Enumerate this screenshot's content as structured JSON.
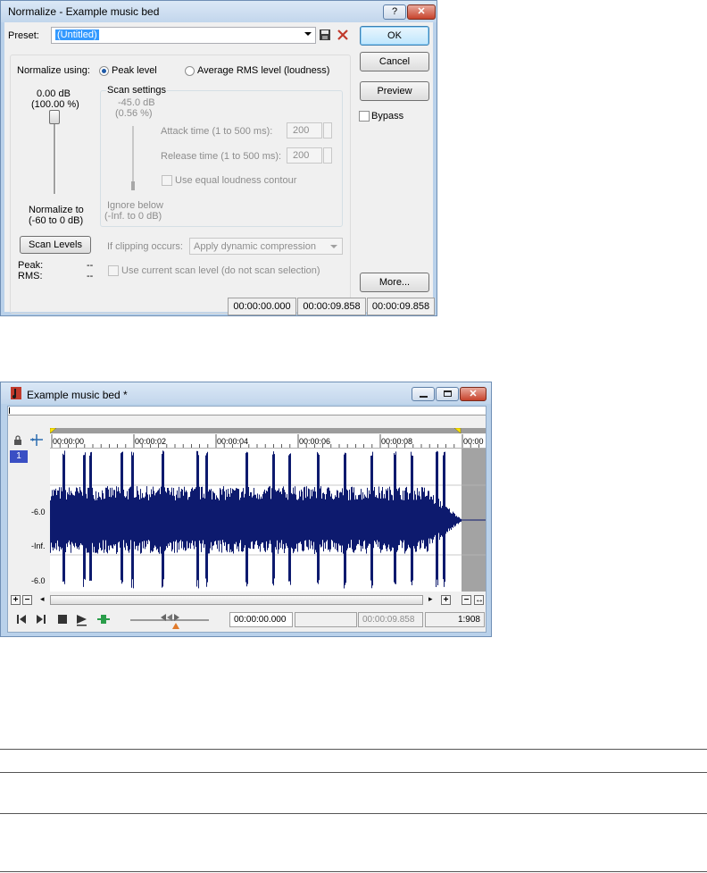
{
  "dialog": {
    "title": "Normalize - Example music bed",
    "help_label": "?",
    "close_label": "✕",
    "preset_label": "Preset:",
    "preset_value": "(Untitled)",
    "ok_label": "OK",
    "cancel_label": "Cancel",
    "preview_label": "Preview",
    "bypass_label": "Bypass",
    "more_label": "More...",
    "normalize_using_label": "Normalize using:",
    "peak_level_label": "Peak level",
    "average_rms_label": "Average RMS level (loudness)",
    "selected_mode": "Peak level",
    "slider_value_db": "0.00 dB",
    "slider_value_pct": "(100.00 %)",
    "slider_level": 1.0,
    "normalize_to_label": "Normalize to",
    "normalize_to_range": "(-60 to 0 dB)",
    "scan_settings_title": "Scan settings",
    "scan_value_db": "-45.0 dB",
    "scan_value_pct": "(0.56 %)",
    "attack_label": "Attack time (1 to 500 ms):",
    "attack_value": "200",
    "release_label": "Release time (1 to 500 ms):",
    "release_value": "200",
    "equal_loudness_label": "Use equal loudness contour",
    "ignore_below_label": "Ignore below",
    "ignore_below_range": "(-Inf. to 0 dB)",
    "scan_levels_label": "Scan Levels",
    "if_clipping_label": "If clipping occurs:",
    "if_clipping_value": "Apply dynamic compression",
    "peak_label": "Peak:",
    "peak_value": "--",
    "rms_label": "RMS:",
    "rms_value": "--",
    "use_current_scan_label": "Use current scan level (do not scan selection)",
    "status": [
      "00:00:00.000",
      "00:00:09.858",
      "00:00:09.858"
    ]
  },
  "editor": {
    "title": "Example music bed *",
    "ruler_ticks": [
      "00:00:00",
      "00:00:02",
      "00:00:04",
      "00:00:06",
      "00:00:08",
      "00:00"
    ],
    "track_number": "1",
    "db_labels": [
      "-6.0",
      "-Inf.",
      "-6.0"
    ],
    "zoom_in": "+",
    "zoom_out": "−",
    "position": "00:00:00.000",
    "selection_start": "",
    "length": "00:00:09.858",
    "zoom_ratio": "1:908",
    "waveform_color": "#0d1a6e"
  }
}
